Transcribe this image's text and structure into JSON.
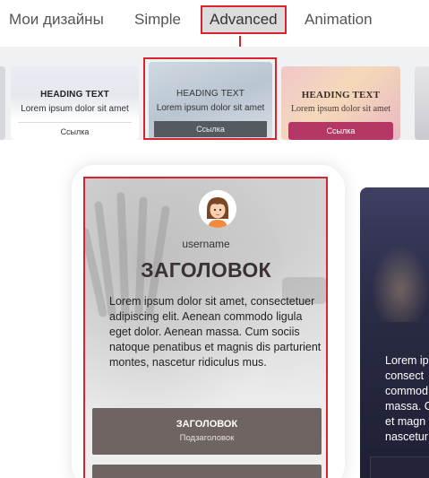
{
  "tabs": [
    {
      "label": "Мои дизайны"
    },
    {
      "label": "Simple"
    },
    {
      "label": "Advanced"
    },
    {
      "label": "Animation"
    }
  ],
  "thumbnails": [
    {
      "heading": "HEADING TEXT",
      "text": "Lorem ipsum dolor sit amet",
      "button": "Ссылка"
    },
    {
      "heading": "HEADING TEXT",
      "text": "Lorem ipsum dolor sit amet",
      "button": "Ссылка"
    },
    {
      "heading": "HEADING TEXT",
      "text": "Lorem ipsum dolor sit amet",
      "button": "Ссылка"
    }
  ],
  "preview": {
    "username": "username",
    "title": "ЗАГОЛОВОК",
    "body": "Lorem ipsum dolor sit amet, consectetuer adipiscing elit. Aenean commodo ligula eget dolor. Aenean massa. Cum sociis natoque penatibus et magnis dis parturient montes, nascetur ridiculus mus.",
    "cta_title": "ЗАГОЛОВОК",
    "cta_subtitle": "Подзаголовок"
  },
  "preview_next": {
    "text_lines": [
      "Lorem ip",
      "consect",
      "commod",
      "massa. C",
      "et magn",
      "nascetur"
    ]
  },
  "colors": {
    "highlight": "#d9232d",
    "cta": "#6e6462",
    "accent_pink": "#b43765"
  }
}
